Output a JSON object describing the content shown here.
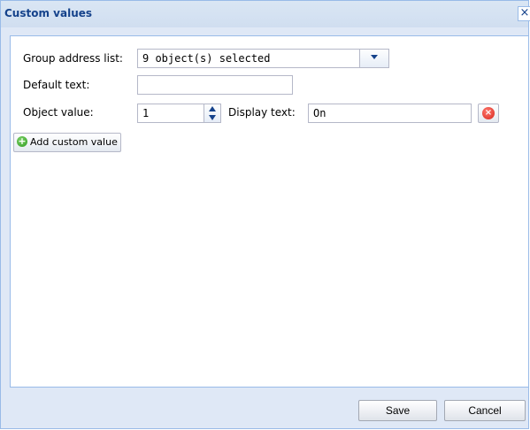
{
  "window": {
    "title": "Custom values",
    "close_glyph": "×"
  },
  "form": {
    "group_address_label": "Group address list:",
    "group_address_value": "9 object(s) selected",
    "default_text_label": "Default text:",
    "default_text_value": "",
    "object_value_label": "Object value:",
    "object_value": "1",
    "display_text_label": "Display text:",
    "display_text_value": "On",
    "add_button_label": "Add custom value"
  },
  "footer": {
    "save_label": "Save",
    "cancel_label": "Cancel"
  },
  "icons": {
    "add": "plus-circle-icon",
    "remove": "remove-circle-icon",
    "combo": "chevron-down-icon",
    "spinner": "spinner-arrows-icon"
  },
  "colors": {
    "title": "#15428b",
    "window_bg": "#dfe8f6",
    "border": "#99bbe8",
    "add_icon": "#2e9a1f",
    "remove_icon": "#d8261c"
  }
}
